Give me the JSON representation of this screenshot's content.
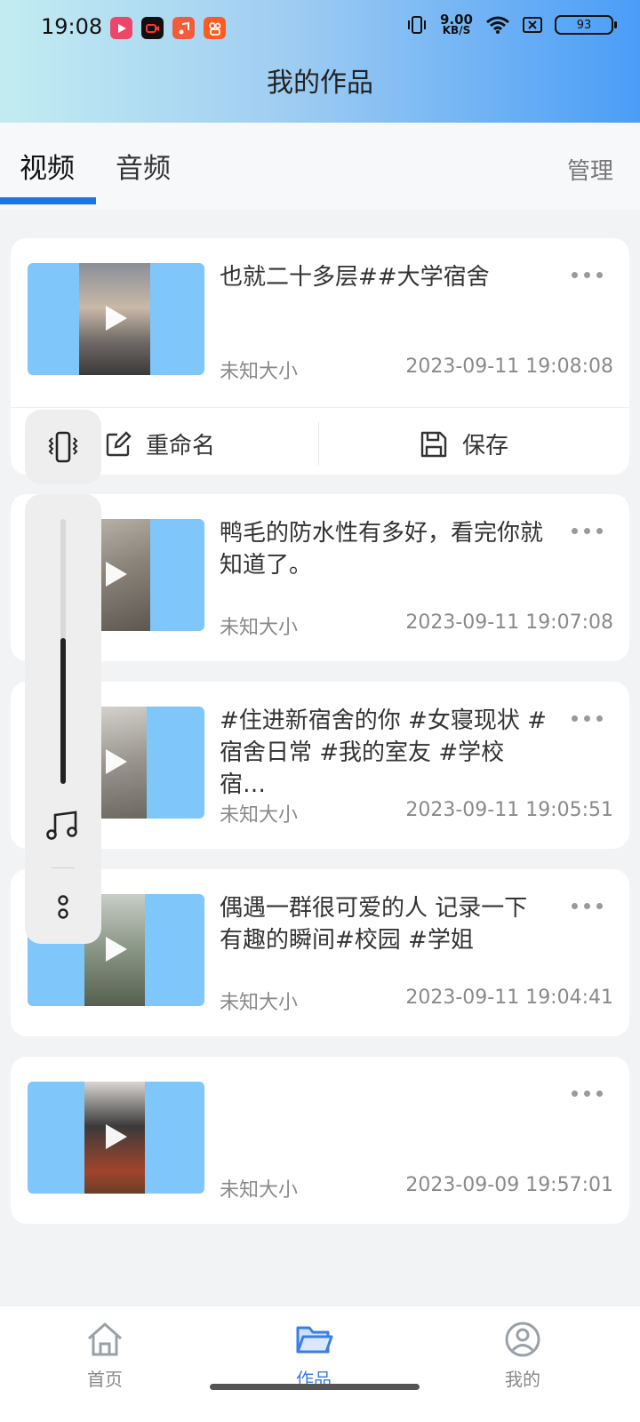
{
  "status": {
    "time": "19:08",
    "net_speed": "9.00",
    "net_unit": "KB/S",
    "battery": "93"
  },
  "header": {
    "title": "我的作品"
  },
  "tabs": [
    {
      "label": "视频"
    },
    {
      "label": "音频"
    }
  ],
  "manage_label": "管理",
  "actions": {
    "rename": "重命名",
    "save": "保存"
  },
  "items": [
    {
      "title": "也就二十多层##大学宿舍",
      "size": "未知大小",
      "date": "2023-09-11 19:08:08"
    },
    {
      "title": "鸭毛的防水性有多好，看完你就知道了。",
      "size": "未知大小",
      "date": "2023-09-11 19:07:08"
    },
    {
      "title": "#住进新宿舍的你 #女寝现状 #宿舍日常 #我的室友 #学校宿…",
      "size": "未知大小",
      "date": "2023-09-11 19:05:51"
    },
    {
      "title": "偶遇一群很可爱的人 记录一下有趣的瞬间#校园 #学姐",
      "size": "未知大小",
      "date": "2023-09-11 19:04:41"
    },
    {
      "title": "",
      "size": "未知大小",
      "date": "2023-09-09 19:57:01"
    }
  ],
  "volume": {
    "level": 0.55
  },
  "nav": [
    {
      "label": "首页"
    },
    {
      "label": "作品"
    },
    {
      "label": "我的"
    }
  ],
  "colors": {
    "accent": "#1f73e8",
    "thumb_bg": "#7fc6fb"
  }
}
